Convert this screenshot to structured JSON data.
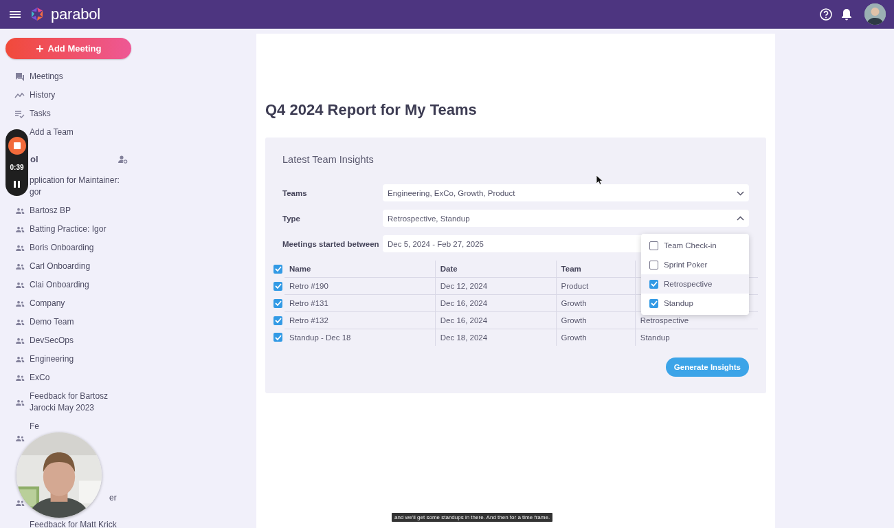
{
  "top_bar": {
    "brand": "parabol"
  },
  "sidebar": {
    "add_button": "Add Meeting",
    "nav": [
      {
        "label": "Meetings",
        "kind": "chat"
      },
      {
        "label": "History",
        "kind": "trend"
      },
      {
        "label": "Tasks",
        "kind": "checklist"
      },
      {
        "label": "Add a Team",
        "kind": "plain"
      }
    ],
    "org_header": "ol",
    "teams": [
      {
        "lines": [
          "pplication for Maintainer:",
          "gor"
        ],
        "kind": "bare"
      },
      {
        "lines": [
          "Bartosz BP"
        ],
        "kind": "team"
      },
      {
        "lines": [
          "Batting Practice: Igor"
        ],
        "kind": "team"
      },
      {
        "lines": [
          "Boris Onboarding"
        ],
        "kind": "team"
      },
      {
        "lines": [
          "Carl Onboarding"
        ],
        "kind": "team"
      },
      {
        "lines": [
          "Clai Onboarding"
        ],
        "kind": "team"
      },
      {
        "lines": [
          "Company"
        ],
        "kind": "team"
      },
      {
        "lines": [
          "Demo Team"
        ],
        "kind": "team"
      },
      {
        "lines": [
          "DevSecOps"
        ],
        "kind": "team"
      },
      {
        "lines": [
          "Engineering"
        ],
        "kind": "team"
      },
      {
        "lines": [
          "ExCo"
        ],
        "kind": "team"
      },
      {
        "lines": [
          "Feedback for Bartosz",
          "Jarocki May 2023"
        ],
        "kind": "team"
      },
      {
        "lines": [
          "Fe"
        ],
        "kind": "top"
      },
      {
        "lines": [
          "er"
        ],
        "kind": "bottom"
      },
      {
        "lines": [
          "Feedback for Matt Krick"
        ],
        "kind": "bare"
      }
    ]
  },
  "report": {
    "title": "Q4 2024 Report for My Teams",
    "card": {
      "heading": "Latest Team Insights",
      "filters": [
        {
          "label": "Teams",
          "value": "Engineering, ExCo, Growth, Product",
          "kind": "select",
          "expanded": false
        },
        {
          "label": "Type",
          "value": "Retrospective, Standup",
          "kind": "select",
          "expanded": true
        },
        {
          "label": "Meetings started between",
          "value": "Dec 5, 2024 - Feb 27, 2025",
          "kind": "date"
        }
      ],
      "type_options": [
        {
          "label": "Team Check-in",
          "checked": false,
          "highlighted": false
        },
        {
          "label": "Sprint Poker",
          "checked": false,
          "highlighted": false
        },
        {
          "label": "Retrospective",
          "checked": true,
          "highlighted": true
        },
        {
          "label": "Standup",
          "checked": true,
          "highlighted": false
        }
      ],
      "table": {
        "select_all_checked": true,
        "columns": [
          "Name",
          "Date",
          "Team"
        ],
        "rows": [
          {
            "checked": true,
            "cells": [
              "Retro #190",
              "Dec 12, 2024",
              "Product"
            ]
          },
          {
            "checked": true,
            "cells": [
              "Retro #131",
              "Dec 16, 2024",
              "Growth"
            ]
          },
          {
            "checked": true,
            "cells": [
              "Retro #132",
              "Dec 16, 2024",
              "Growth",
              "Retrospective"
            ]
          },
          {
            "checked": true,
            "cells": [
              "Standup - Dec 18",
              "Dec 18, 2024",
              "Growth",
              "Standup"
            ]
          }
        ]
      },
      "button": "Generate Insights"
    }
  },
  "recorder": {
    "time": "0:39"
  },
  "caption": {
    "text": "and we'll get some standups in there. And then for a time frame."
  }
}
